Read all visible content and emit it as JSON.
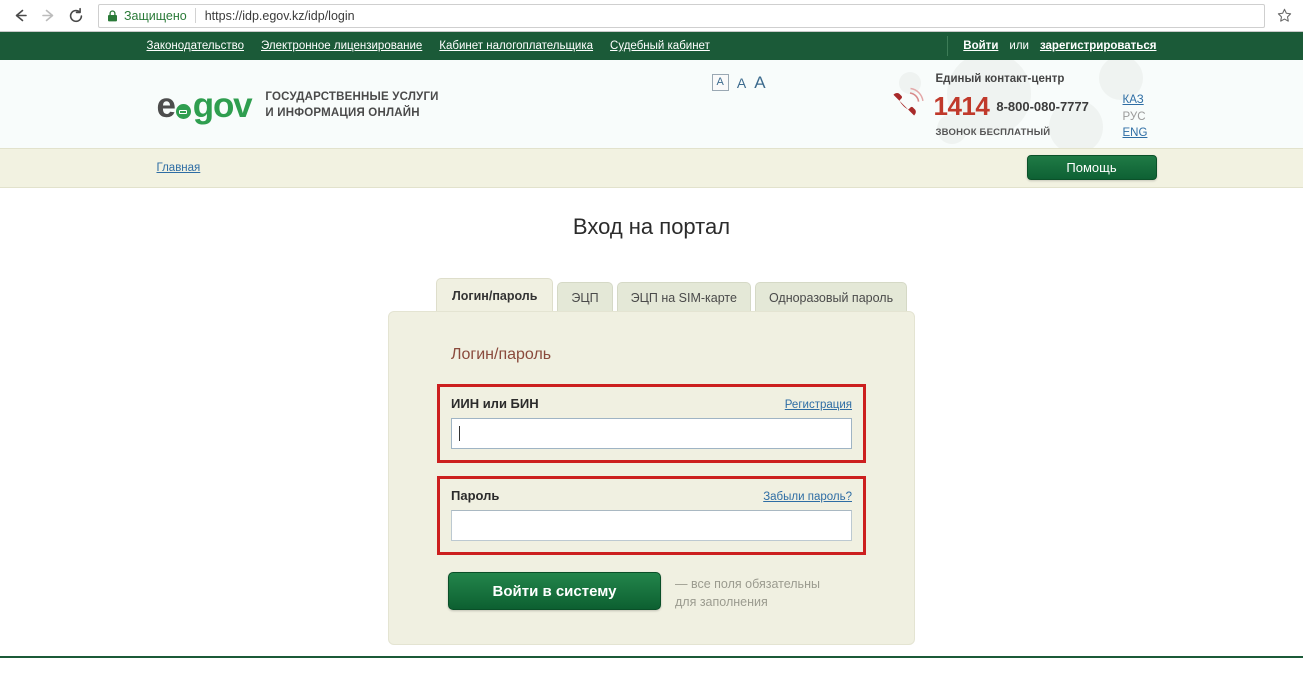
{
  "browser": {
    "back_icon": "back-arrow-icon",
    "forward_icon": "forward-arrow-icon",
    "reload_icon": "reload-icon",
    "lock_icon": "lock-icon",
    "secure_label": "Защищено",
    "url": "https://idp.egov.kz/idp/login",
    "bookmark_icon": "star-icon"
  },
  "topnav": {
    "links": [
      {
        "label": "Законодательство"
      },
      {
        "label": "Электронное лицензирование"
      },
      {
        "label": "Кабинет налогоплательщика"
      },
      {
        "label": "Судебный кабинет"
      }
    ],
    "login_label": "Войти",
    "separator": "или",
    "register_label": "зарегистрироваться"
  },
  "header": {
    "logo": {
      "e": "e",
      "dot_icon": "egov-circle-arrow-icon",
      "gov": "gov",
      "tagline_line1": "ГОСУДАРСТВЕННЫЕ УСЛУГИ",
      "tagline_line2": "И ИНФОРМАЦИЯ ОНЛАЙН"
    },
    "fontsize": {
      "small": "A",
      "medium": "A",
      "large": "A"
    },
    "contact": {
      "title": "Единый контакт-центр",
      "phone_icon": "telephone-icon",
      "short_number": "1414",
      "full_number": "8-800-080-7777",
      "free_note": "ЗВОНОК БЕСПЛАТНЫЙ"
    },
    "languages": [
      {
        "code": "КАЗ",
        "active": false
      },
      {
        "code": "РУС",
        "active": true
      },
      {
        "code": "ENG",
        "active": false
      }
    ]
  },
  "crumbbar": {
    "home_label": "Главная",
    "help_label": "Помощь"
  },
  "main": {
    "page_title": "Вход на портал",
    "tabs": [
      {
        "label": "Логин/пароль",
        "active": true
      },
      {
        "label": "ЭЦП",
        "active": false
      },
      {
        "label": "ЭЦП на SIM-карте",
        "active": false
      },
      {
        "label": "Одноразовый пароль",
        "active": false
      }
    ],
    "card_heading": "Логин/пароль",
    "fields": [
      {
        "label": "ИИН или БИН",
        "link": "Регистрация",
        "value": "",
        "focused": true
      },
      {
        "label": "Пароль",
        "link": "Забыли пароль?",
        "value": "",
        "focused": false
      }
    ],
    "submit_label": "Войти в систему",
    "required_note": "— все поля обязательны для заполнения"
  },
  "colors": {
    "brand_green": "#1b5a38",
    "logo_green": "#2f9e4f",
    "accent_red": "#cc1f1f",
    "phone_red": "#c0392b",
    "heading_brown": "#8a4a3c",
    "link_blue": "#2e6da4",
    "card_cream": "#f0f0e1",
    "bar_cream": "#f2f2e1"
  }
}
